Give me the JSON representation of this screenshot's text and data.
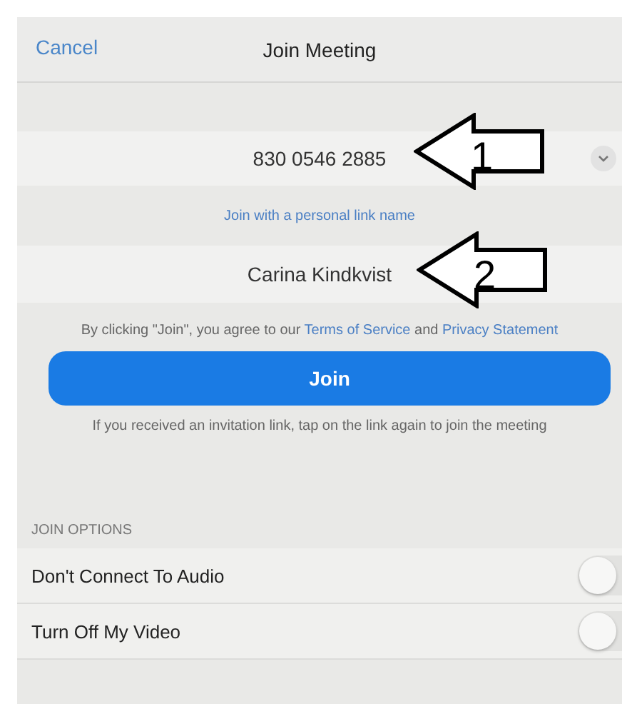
{
  "navigation_bar": {
    "cancel": "Cancel",
    "title": "Join Meeting"
  },
  "meeting_id": {
    "value": "830 0546 2885",
    "annotation": "1"
  },
  "personal_link": "Join with a personal link name",
  "display_name": {
    "value": "Carina Kindkvist",
    "annotation": "2"
  },
  "agreement": {
    "prefix": "By clicking \"Join\", you agree to our",
    "terms": "Terms of Service",
    "connector": "and",
    "privacy": "Privacy Statement"
  },
  "join_button": "Join",
  "invitation_note": "If you received an invitation link, tap on the link again to join the meeting",
  "join_options": {
    "heading": "JOIN OPTIONS",
    "items": [
      {
        "label": "Don't Connect To Audio",
        "on": false
      },
      {
        "label": "Turn Off My Video",
        "on": false
      }
    ]
  }
}
